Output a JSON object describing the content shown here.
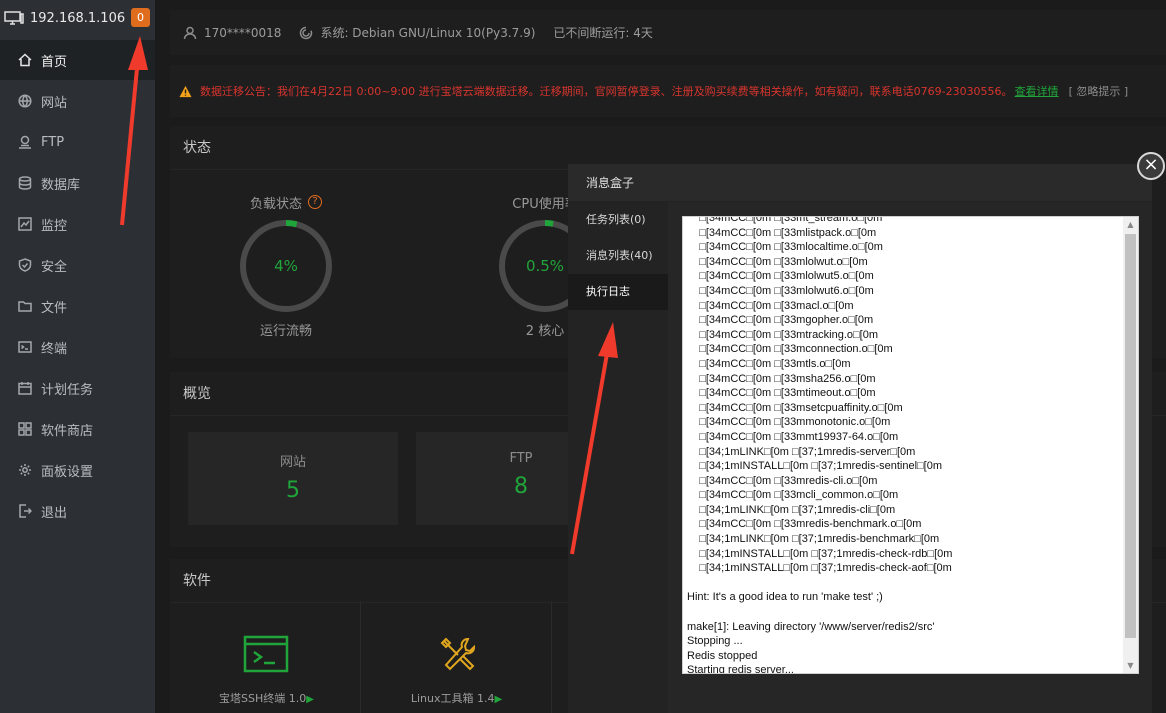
{
  "sidebar": {
    "ip": "192.168.1.106",
    "badge": "0",
    "items": [
      {
        "label": "首页",
        "icon": "home-icon"
      },
      {
        "label": "网站",
        "icon": "globe-icon"
      },
      {
        "label": "FTP",
        "icon": "ftp-icon"
      },
      {
        "label": "数据库",
        "icon": "database-icon"
      },
      {
        "label": "监控",
        "icon": "monitor-icon"
      },
      {
        "label": "安全",
        "icon": "shield-icon"
      },
      {
        "label": "文件",
        "icon": "folder-icon"
      },
      {
        "label": "终端",
        "icon": "terminal-icon"
      },
      {
        "label": "计划任务",
        "icon": "calendar-icon"
      },
      {
        "label": "软件商店",
        "icon": "grid-icon"
      },
      {
        "label": "面板设置",
        "icon": "gear-icon"
      },
      {
        "label": "退出",
        "icon": "logout-icon"
      }
    ]
  },
  "topbar": {
    "user": "170****0018",
    "system": "系统:  Debian GNU/Linux 10(Py3.7.9)",
    "uptime": "已不间断运行: 4天"
  },
  "notice": {
    "message": "数据迁移公告：我们在4月22日 0:00~9:00 进行宝塔云端数据迁移。迁移期间，官网暂停登录、注册及购买续费等相关操作，如有疑问，联系电话0769-23030556。",
    "link": "查看详情",
    "ignore": "[ 忽略提示 ]"
  },
  "status": {
    "title": "状态",
    "load": {
      "label": "负载状态",
      "value": "4%",
      "percent": 4,
      "sub": "运行流畅"
    },
    "cpu": {
      "label": "CPU使用率",
      "value": "0.5%",
      "percent": 0.5,
      "sub": "2 核心"
    }
  },
  "overview": {
    "title": "概览",
    "stats": [
      {
        "label": "网站",
        "value": "5"
      },
      {
        "label": "FTP",
        "value": "8"
      }
    ]
  },
  "software": {
    "title": "软件",
    "items": [
      {
        "name": "宝塔SSH终端 1.0"
      },
      {
        "name": "Linux工具箱 1.4"
      }
    ]
  },
  "modal": {
    "title": "消息盒子",
    "tabs": [
      "任务列表(0)",
      "消息列表(40)",
      "执行日志"
    ],
    "log": [
      "    \u0000[34mCC\u0000[0m \u0000[33mt_stream.o\u0000[0m",
      "    \u0000[34mCC\u0000[0m \u0000[33mlistpack.o\u0000[0m",
      "    \u0000[34mCC\u0000[0m \u0000[33mlocaltime.o\u0000[0m",
      "    \u0000[34mCC\u0000[0m \u0000[33mlolwut.o\u0000[0m",
      "    \u0000[34mCC\u0000[0m \u0000[33mlolwut5.o\u0000[0m",
      "    \u0000[34mCC\u0000[0m \u0000[33mlolwut6.o\u0000[0m",
      "    \u0000[34mCC\u0000[0m \u0000[33macl.o\u0000[0m",
      "    \u0000[34mCC\u0000[0m \u0000[33mgopher.o\u0000[0m",
      "    \u0000[34mCC\u0000[0m \u0000[33mtracking.o\u0000[0m",
      "    \u0000[34mCC\u0000[0m \u0000[33mconnection.o\u0000[0m",
      "    \u0000[34mCC\u0000[0m \u0000[33mtls.o\u0000[0m",
      "    \u0000[34mCC\u0000[0m \u0000[33msha256.o\u0000[0m",
      "    \u0000[34mCC\u0000[0m \u0000[33mtimeout.o\u0000[0m",
      "    \u0000[34mCC\u0000[0m \u0000[33msetcpuaffinity.o\u0000[0m",
      "    \u0000[34mCC\u0000[0m \u0000[33mmonotonic.o\u0000[0m",
      "    \u0000[34mCC\u0000[0m \u0000[33mmt19937-64.o\u0000[0m",
      "    \u0000[34;1mLINK\u0000[0m \u0000[37;1mredis-server\u0000[0m",
      "    \u0000[34;1mINSTALL\u0000[0m \u0000[37;1mredis-sentinel\u0000[0m",
      "    \u0000[34mCC\u0000[0m \u0000[33mredis-cli.o\u0000[0m",
      "    \u0000[34mCC\u0000[0m \u0000[33mcli_common.o\u0000[0m",
      "    \u0000[34;1mLINK\u0000[0m \u0000[37;1mredis-cli\u0000[0m",
      "    \u0000[34mCC\u0000[0m \u0000[33mredis-benchmark.o\u0000[0m",
      "    \u0000[34;1mLINK\u0000[0m \u0000[37;1mredis-benchmark\u0000[0m",
      "    \u0000[34;1mINSTALL\u0000[0m \u0000[37;1mredis-check-rdb\u0000[0m",
      "    \u0000[34;1mINSTALL\u0000[0m \u0000[37;1mredis-check-aof\u0000[0m",
      "",
      "Hint: It's a good idea to run 'make test' ;)",
      "",
      "make[1]: Leaving directory '/www/server/redis2/src'",
      "Stopping ...",
      "Redis stopped",
      "Starting redis server..."
    ]
  }
}
